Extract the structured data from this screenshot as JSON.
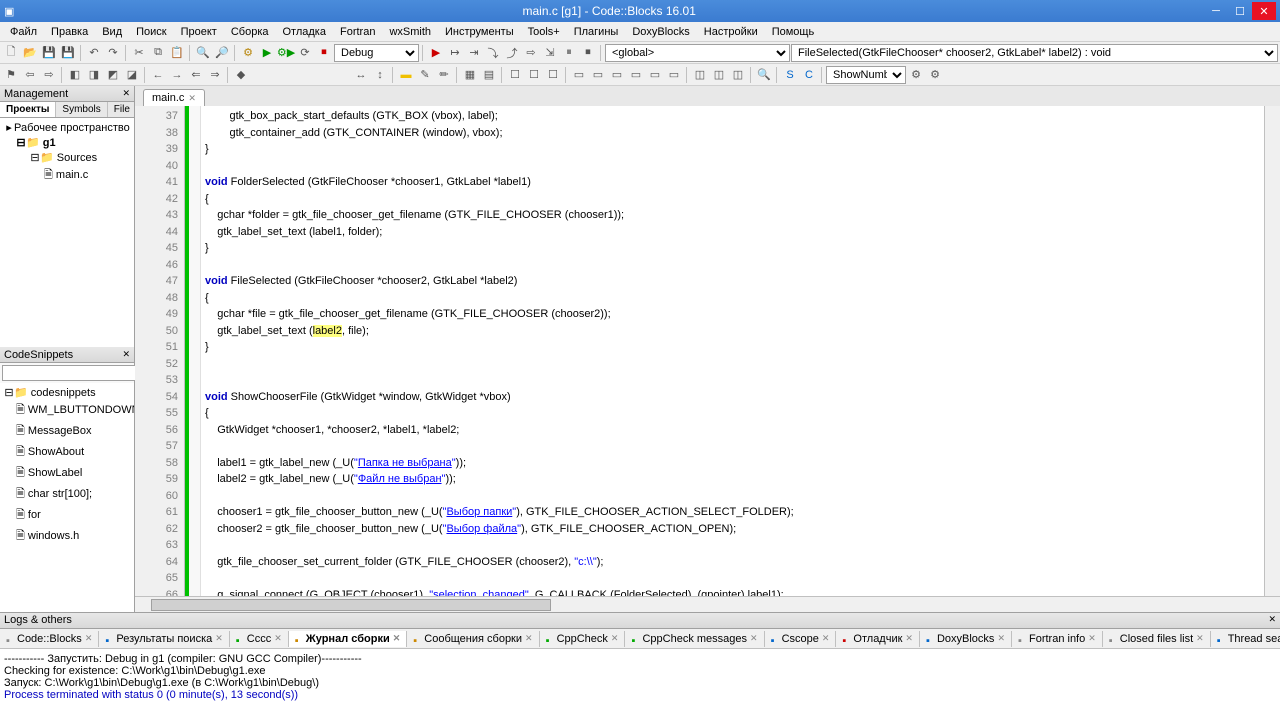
{
  "title": "main.c [g1] - Code::Blocks 16.01",
  "menu": [
    "Файл",
    "Правка",
    "Вид",
    "Поиск",
    "Проект",
    "Сборка",
    "Отладка",
    "Fortran",
    "wxSmith",
    "Инструменты",
    "Tools+",
    "Плагины",
    "DoxyBlocks",
    "Настройки",
    "Помощь"
  ],
  "toolbar": {
    "build_config": "Debug",
    "scope": "<global>",
    "symbol": "FileSelected(GtkFileChooser* chooser2, GtkLabel* label2) : void",
    "aux_select": "ShowNumber"
  },
  "management": {
    "title": "Management",
    "tabs": [
      "Проекты",
      "Symbols",
      "File"
    ],
    "active_tab": 0,
    "tree": {
      "workspace": "Рабочее пространство",
      "project": "g1",
      "folder": "Sources",
      "file": "main.c"
    }
  },
  "snippets": {
    "title": "CodeSnippets",
    "root": "codesnippets",
    "items": [
      "WM_LBUTTONDOWN",
      "MessageBox",
      "ShowAbout",
      "ShowLabel",
      "char str[100];",
      "for",
      "windows.h"
    ]
  },
  "editor": {
    "file_tab": "main.c",
    "first_line": 37,
    "lines": [
      {
        "n": 37,
        "segs": [
          {
            "t": "        gtk_box_pack_start_defaults (GTK_BOX (vbox), label);"
          }
        ]
      },
      {
        "n": 38,
        "segs": [
          {
            "t": "        gtk_container_add (GTK_CONTAINER (window), vbox);"
          }
        ]
      },
      {
        "n": 39,
        "segs": [
          {
            "t": "}"
          }
        ]
      },
      {
        "n": 40,
        "segs": [
          {
            "t": ""
          }
        ]
      },
      {
        "n": 41,
        "segs": [
          {
            "t": "void",
            "c": "kw"
          },
          {
            "t": " FolderSelected (GtkFileChooser *chooser1, GtkLabel *label1)"
          }
        ]
      },
      {
        "n": 42,
        "segs": [
          {
            "t": "{"
          }
        ]
      },
      {
        "n": 43,
        "segs": [
          {
            "t": "    gchar *folder = gtk_file_chooser_get_filename (GTK_FILE_CHOOSER (chooser1));"
          }
        ]
      },
      {
        "n": 44,
        "segs": [
          {
            "t": "    gtk_label_set_text (label1, folder);"
          }
        ]
      },
      {
        "n": 45,
        "segs": [
          {
            "t": "}"
          }
        ]
      },
      {
        "n": 46,
        "segs": [
          {
            "t": ""
          }
        ]
      },
      {
        "n": 47,
        "segs": [
          {
            "t": "void",
            "c": "kw"
          },
          {
            "t": " FileSelected (GtkFileChooser *chooser2, GtkLabel *label2)"
          }
        ]
      },
      {
        "n": 48,
        "segs": [
          {
            "t": "{"
          }
        ]
      },
      {
        "n": 49,
        "segs": [
          {
            "t": "    gchar *file = gtk_file_chooser_get_filename (GTK_FILE_CHOOSER (chooser2));"
          }
        ]
      },
      {
        "n": 50,
        "segs": [
          {
            "t": "    gtk_label_set_text ("
          },
          {
            "t": "label2",
            "c": "hl"
          },
          {
            "t": ", file);"
          }
        ]
      },
      {
        "n": 51,
        "segs": [
          {
            "t": "}"
          }
        ]
      },
      {
        "n": 52,
        "segs": [
          {
            "t": ""
          }
        ]
      },
      {
        "n": 53,
        "segs": [
          {
            "t": ""
          }
        ]
      },
      {
        "n": 54,
        "segs": [
          {
            "t": "void",
            "c": "kw"
          },
          {
            "t": " ShowChooserFile (GtkWidget *window, GtkWidget *vbox)"
          }
        ]
      },
      {
        "n": 55,
        "segs": [
          {
            "t": "{"
          }
        ]
      },
      {
        "n": 56,
        "segs": [
          {
            "t": "    GtkWidget *chooser1, *chooser2, *label1, *label2;"
          }
        ]
      },
      {
        "n": 57,
        "segs": [
          {
            "t": ""
          }
        ]
      },
      {
        "n": 58,
        "segs": [
          {
            "t": "    label1 = gtk_label_new (_U("
          },
          {
            "t": "\"",
            "c": "str"
          },
          {
            "t": "Папка не выбрана",
            "c": "ru"
          },
          {
            "t": "\"",
            "c": "str"
          },
          {
            "t": "));"
          }
        ]
      },
      {
        "n": 59,
        "segs": [
          {
            "t": "    label2 = gtk_label_new (_U("
          },
          {
            "t": "\"",
            "c": "str"
          },
          {
            "t": "Файл не выбран",
            "c": "ru"
          },
          {
            "t": "\"",
            "c": "str"
          },
          {
            "t": "));"
          }
        ]
      },
      {
        "n": 60,
        "segs": [
          {
            "t": ""
          }
        ]
      },
      {
        "n": 61,
        "segs": [
          {
            "t": "    chooser1 = gtk_file_chooser_button_new (_U("
          },
          {
            "t": "\"",
            "c": "str"
          },
          {
            "t": "Выбор папки",
            "c": "ru"
          },
          {
            "t": "\"",
            "c": "str"
          },
          {
            "t": "), GTK_FILE_CHOOSER_ACTION_SELECT_FOLDER);"
          }
        ]
      },
      {
        "n": 62,
        "segs": [
          {
            "t": "    chooser2 = gtk_file_chooser_button_new (_U("
          },
          {
            "t": "\"",
            "c": "str"
          },
          {
            "t": "Выбор файла",
            "c": "ru"
          },
          {
            "t": "\"",
            "c": "str"
          },
          {
            "t": "), GTK_FILE_CHOOSER_ACTION_OPEN);"
          }
        ]
      },
      {
        "n": 63,
        "segs": [
          {
            "t": ""
          }
        ]
      },
      {
        "n": 64,
        "segs": [
          {
            "t": "    gtk_file_chooser_set_current_folder (GTK_FILE_CHOOSER (chooser2), "
          },
          {
            "t": "\"c:\\\\\"",
            "c": "str"
          },
          {
            "t": ");"
          }
        ]
      },
      {
        "n": 65,
        "segs": [
          {
            "t": ""
          }
        ]
      },
      {
        "n": 66,
        "segs": [
          {
            "t": "    g_signal_connect (G_OBJECT (chooser1), "
          },
          {
            "t": "\"selection_changed\"",
            "c": "str"
          },
          {
            "t": ", G_CALLBACK (FolderSelected), (gpointer) label1);"
          }
        ]
      }
    ]
  },
  "logs": {
    "title": "Logs & others",
    "tabs": [
      "Code::Blocks",
      "Результаты поиска",
      "Cccc",
      "Журнал сборки",
      "Сообщения сборки",
      "CppCheck",
      "CppCheck messages",
      "Cscope",
      "Отладчик",
      "DoxyBlocks",
      "Fortran info",
      "Closed files list",
      "Thread search"
    ],
    "active_tab": 3,
    "lines": [
      "----------- Запустить: Debug in g1 (compiler: GNU GCC Compiler)-----------",
      "Checking for existence: C:\\Work\\g1\\bin\\Debug\\g1.exe",
      "Запуск: C:\\Work\\g1\\bin\\Debug\\g1.exe  (в C:\\Work\\g1\\bin\\Debug\\)",
      "Process terminated with status 0 (0 minute(s), 13 second(s))"
    ]
  }
}
